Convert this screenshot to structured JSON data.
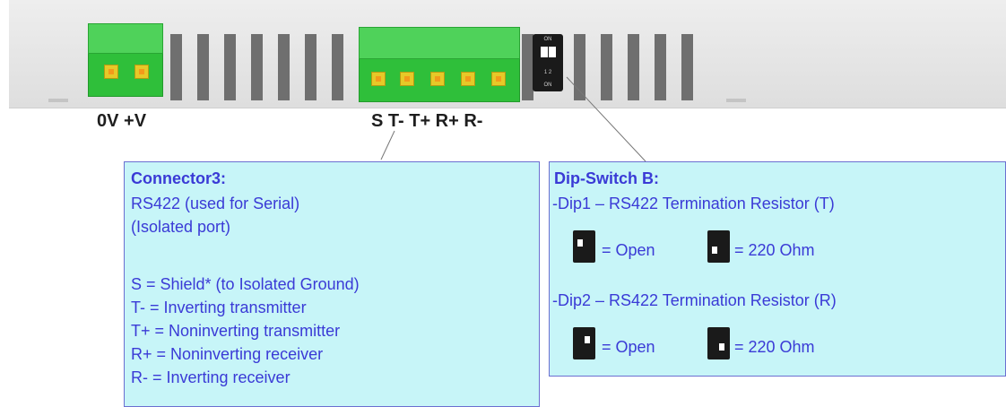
{
  "device": {
    "power_terminal_label": "0V +V",
    "serial_terminal_label": "S T- T+ R+ R-",
    "dip_switch_text_top": "ON",
    "dip_switch_text_mid": "1 2",
    "dip_switch_text_bottom": "ON"
  },
  "connector3": {
    "title": "Connector3:",
    "line1": "RS422 (used for Serial)",
    "line2": "(Isolated port)",
    "pins": [
      "S = Shield* (to Isolated Ground)",
      "T- = Inverting transmitter",
      "T+ = Noninverting transmitter",
      "R+ = Noninverting receiver",
      "R- = Inverting receiver"
    ]
  },
  "dip_switch_b": {
    "title": "Dip-Switch B:",
    "dip1_title": "-Dip1 – RS422 Termination Resistor (T)",
    "dip2_title": "-Dip2 – RS422 Termination Resistor (R)",
    "open_label": "= Open",
    "ohm_label": "= 220 Ohm"
  },
  "colors": {
    "terminal_green": "#2fbf3a",
    "box_fill": "#c7f5f8",
    "box_border": "#6b6fd1",
    "box_text": "#3a3ad6"
  }
}
